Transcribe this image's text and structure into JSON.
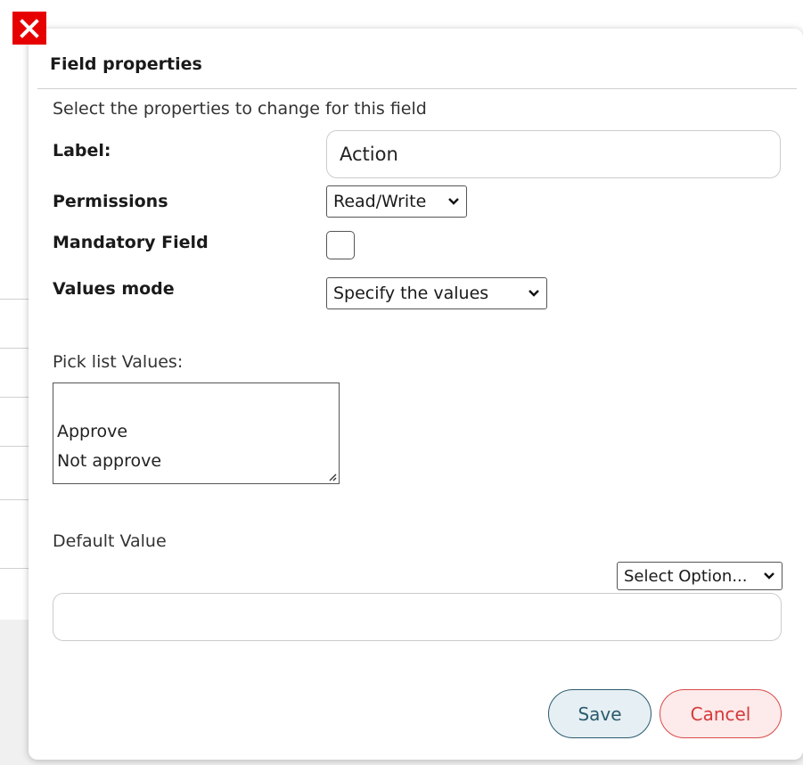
{
  "dialog": {
    "title": "Field properties",
    "subtitle": "Select the properties to change for this field"
  },
  "fields": {
    "label": {
      "label": "Label:",
      "value": "Action"
    },
    "permissions": {
      "label": "Permissions",
      "selected": "Read/Write"
    },
    "mandatory": {
      "label": "Mandatory Field",
      "checked": false
    },
    "values_mode": {
      "label": "Values mode",
      "selected": "Specify the values"
    },
    "pick_list": {
      "label": "Pick list Values:",
      "values": [
        "Approve",
        "Not approve"
      ]
    },
    "default_value": {
      "label": "Default Value",
      "selected": "Select Option...",
      "value": ""
    }
  },
  "buttons": {
    "save": "Save",
    "cancel": "Cancel"
  },
  "colors": {
    "close": "#e60000",
    "save_border": "#2b5b6e",
    "cancel_border": "#d94a4a"
  },
  "icons": {
    "close": "close-icon",
    "dropdown": "chevron-down-icon",
    "resize": "resize-grip-icon"
  }
}
